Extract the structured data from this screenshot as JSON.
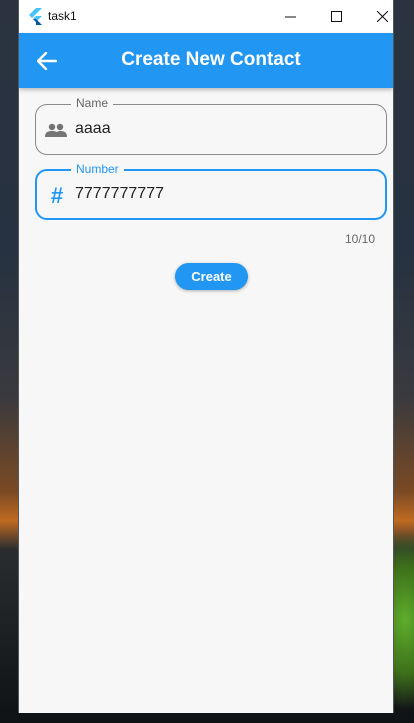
{
  "window": {
    "title": "task1"
  },
  "appbar": {
    "title": "Create New Contact",
    "back_icon": "arrow-back-icon"
  },
  "form": {
    "name_field": {
      "label": "Name",
      "value": "aaaa",
      "icon": "people-icon"
    },
    "number_field": {
      "label": "Number",
      "value": "7777777777",
      "icon": "hash-icon",
      "prefix": "#",
      "counter": "10/10"
    },
    "create_label": "Create"
  },
  "colors": {
    "primary": "#2196f3",
    "background": "#f7f7f7"
  }
}
